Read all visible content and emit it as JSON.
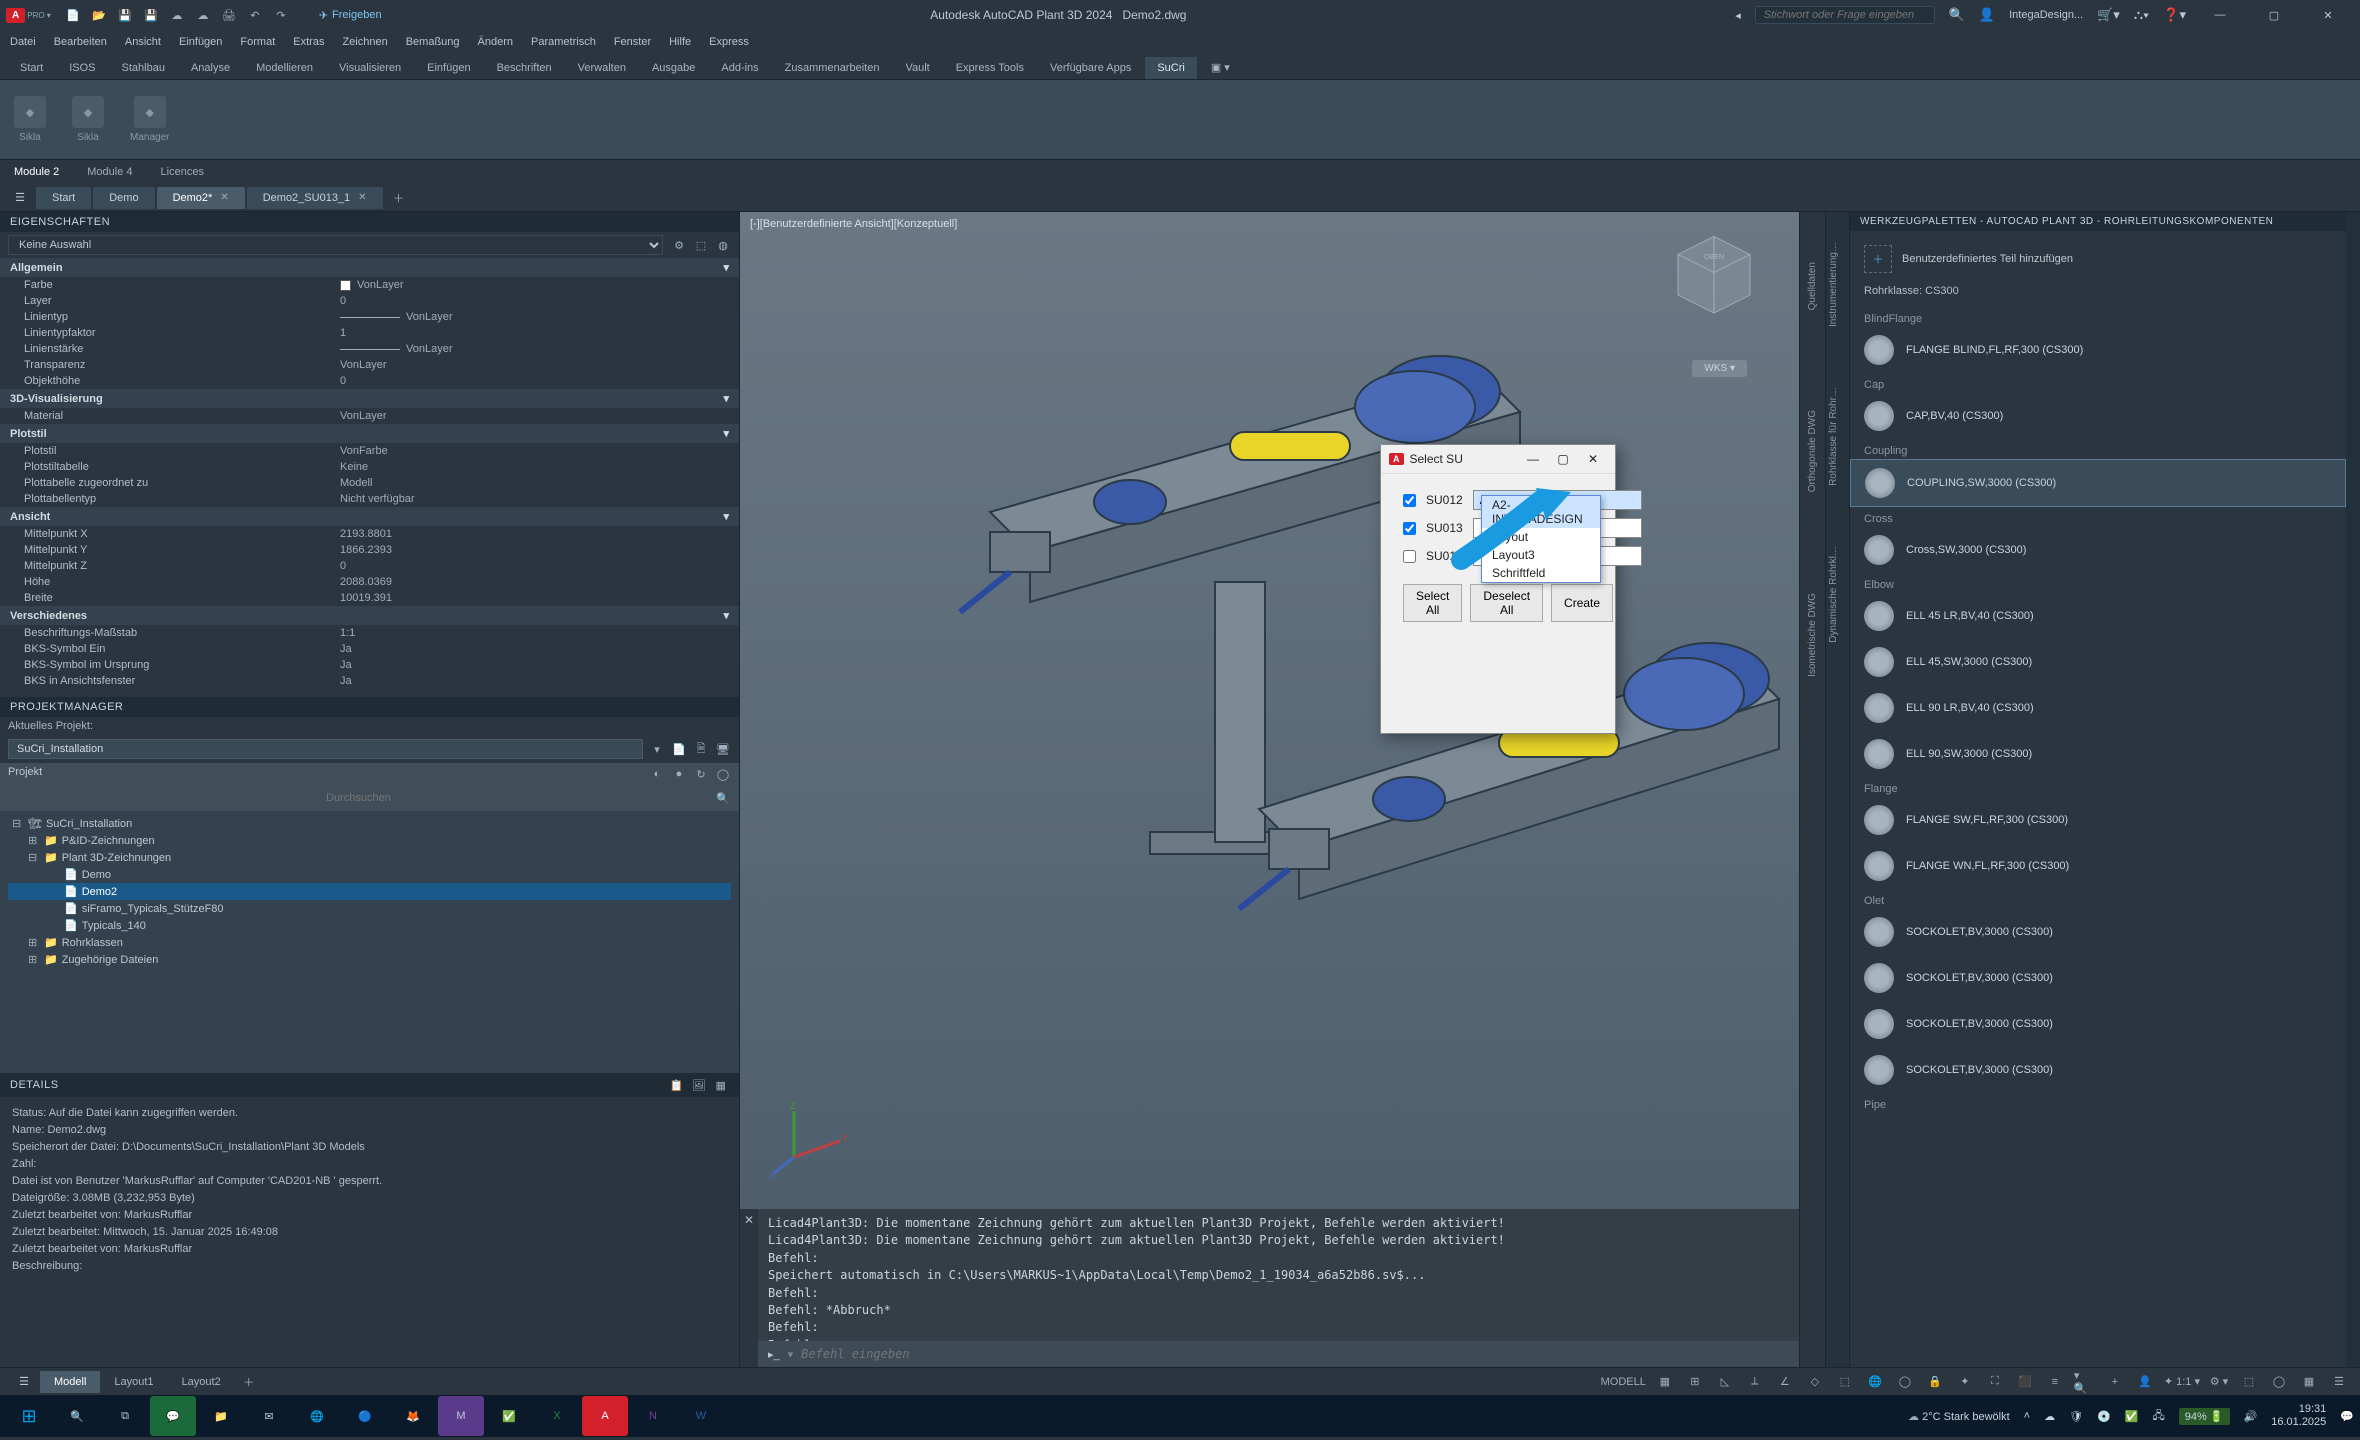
{
  "title_bar": {
    "app_name": "Autodesk AutoCAD Plant 3D 2024",
    "doc_name": "Demo2.dwg",
    "share_label": "Freigeben",
    "search_placeholder": "Stichwort oder Frage eingeben",
    "user_label": "IntegaDesign..."
  },
  "menus": [
    "Datei",
    "Bearbeiten",
    "Ansicht",
    "Einfügen",
    "Format",
    "Extras",
    "Zeichnen",
    "Bemaßung",
    "Ändern",
    "Parametrisch",
    "Fenster",
    "Hilfe",
    "Express"
  ],
  "ribbon_tabs": [
    "Start",
    "ISOS",
    "Stahlbau",
    "Analyse",
    "Modellieren",
    "Visualisieren",
    "Einfügen",
    "Beschriften",
    "Verwalten",
    "Ausgabe",
    "Add-ins",
    "Zusammenarbeiten",
    "Vault",
    "Express Tools",
    "Verfügbare Apps",
    "SuCri"
  ],
  "ribbon_btns": [
    {
      "label": "Sikla"
    },
    {
      "label": "Sikla"
    },
    {
      "label": "Manager"
    }
  ],
  "sub_tabs": [
    "Module 2",
    "Module 4",
    "Licences"
  ],
  "file_tabs": [
    {
      "label": "Start",
      "closable": false
    },
    {
      "label": "Demo",
      "closable": false
    },
    {
      "label": "Demo2*",
      "closable": true,
      "active": true
    },
    {
      "label": "Demo2_SU013_1",
      "closable": true
    }
  ],
  "props_header": "EIGENSCHAFTEN",
  "props_selection": "Keine Auswahl",
  "prop_sections": {
    "allgemein": {
      "title": "Allgemein",
      "rows": [
        {
          "label": "Farbe",
          "value": "VonLayer",
          "swatch": true
        },
        {
          "label": "Layer",
          "value": "0"
        },
        {
          "label": "Linientyp",
          "value": "VonLayer",
          "line": true
        },
        {
          "label": "Linientypfaktor",
          "value": "1"
        },
        {
          "label": "Linienstärke",
          "value": "VonLayer",
          "line": true
        },
        {
          "label": "Transparenz",
          "value": "VonLayer"
        },
        {
          "label": "Objekthöhe",
          "value": "0"
        }
      ]
    },
    "vis3d": {
      "title": "3D-Visualisierung",
      "rows": [
        {
          "label": "Material",
          "value": "VonLayer"
        }
      ]
    },
    "plotstil": {
      "title": "Plotstil",
      "rows": [
        {
          "label": "Plotstil",
          "value": "VonFarbe"
        },
        {
          "label": "Plotstiltabelle",
          "value": "Keine"
        },
        {
          "label": "Plottabelle zugeordnet zu",
          "value": "Modell"
        },
        {
          "label": "Plottabellentyp",
          "value": "Nicht verfügbar"
        }
      ]
    },
    "ansicht": {
      "title": "Ansicht",
      "rows": [
        {
          "label": "Mittelpunkt X",
          "value": "2193.8801"
        },
        {
          "label": "Mittelpunkt Y",
          "value": "1866.2393"
        },
        {
          "label": "Mittelpunkt Z",
          "value": "0"
        },
        {
          "label": "Höhe",
          "value": "2088.0369"
        },
        {
          "label": "Breite",
          "value": "10019.391"
        }
      ]
    },
    "verschiedenes": {
      "title": "Verschiedenes",
      "rows": [
        {
          "label": "Beschriftungs-Maßstab",
          "value": "1:1"
        },
        {
          "label": "BKS-Symbol Ein",
          "value": "Ja"
        },
        {
          "label": "BKS-Symbol im Ursprung",
          "value": "Ja"
        },
        {
          "label": "BKS in Ansichtsfenster",
          "value": "Ja"
        }
      ]
    }
  },
  "projman_header": "PROJEKTMANAGER",
  "projman_current_label": "Aktuelles Projekt:",
  "projman_current_value": "SuCri_Installation",
  "projman_proj_label": "Projekt",
  "projman_search_placeholder": "Durchsuchen",
  "proj_tree": [
    {
      "label": "SuCri_Installation",
      "indent": 0,
      "exp": "-",
      "ico": "proj"
    },
    {
      "label": "P&ID-Zeichnungen",
      "indent": 1,
      "exp": "+",
      "ico": "folder"
    },
    {
      "label": "Plant 3D-Zeichnungen",
      "indent": 1,
      "exp": "-",
      "ico": "folder"
    },
    {
      "label": "Demo",
      "indent": 2,
      "exp": "",
      "ico": "dwg"
    },
    {
      "label": "Demo2",
      "indent": 2,
      "exp": "",
      "ico": "dwg",
      "selected": true
    },
    {
      "label": "siFramo_Typicals_StützeF80",
      "indent": 2,
      "exp": "",
      "ico": "dwg"
    },
    {
      "label": "Typicals_140",
      "indent": 2,
      "exp": "",
      "ico": "dwg"
    },
    {
      "label": "Rohrklassen",
      "indent": 1,
      "exp": "+",
      "ico": "folder"
    },
    {
      "label": "Zugehörige Dateien",
      "indent": 1,
      "exp": "+",
      "ico": "folder"
    }
  ],
  "details_header": "Details",
  "details_lines": [
    "Status: Auf die Datei kann zugegriffen werden.",
    "Name: Demo2.dwg",
    "Speicherort der Datei: D:\\Documents\\SuCri_Installation\\Plant 3D Models",
    "Zahl:",
    "Datei ist von Benutzer 'MarkusRufflar' auf Computer 'CAD201-NB ' gesperrt.",
    "Dateigröße: 3.08MB (3,232,953 Byte)",
    "Zuletzt bearbeitet von: MarkusRufflar",
    "Zuletzt bearbeitet: Mittwoch, 15. Januar 2025 16:49:08",
    "Zuletzt bearbeitet von: MarkusRufflar",
    "Beschreibung:"
  ],
  "viewport_label": "[-][Benutzerdefinierte Ansicht][Konzeptuell]",
  "wks_label": "WKS",
  "dialog": {
    "title": "Select SU",
    "rows": [
      {
        "id": "SU012",
        "value": "A2-INTEGADESIGN",
        "checked": true
      },
      {
        "id": "SU013",
        "value": "",
        "checked": true
      },
      {
        "id": "SU014",
        "value": "",
        "checked": false
      }
    ],
    "dropdown": [
      "A2-INTEGADESIGN",
      "Layout",
      "Layout3",
      "Schriftfeld"
    ],
    "buttons": {
      "select_all": "Select All",
      "deselect_all": "Deselect All",
      "create": "Create"
    }
  },
  "palette_header": "WERKZEUGPALETTEN - AUTOCAD PLANT 3D - ROHRLEITUNGSKOMPONENTEN",
  "palette_custom": "Benutzerdefiniertes Teil hinzufügen",
  "palette_vtabs": [
    "Instrumentierung…",
    "Rohrklasse für Rohr…",
    "Dynamische Rohrkl…"
  ],
  "palette_class": "Rohrklasse: CS300",
  "palette_groups": [
    {
      "title": "BlindFlange",
      "items": [
        "FLANGE BLIND,FL,RF,300 (CS300)"
      ]
    },
    {
      "title": "Cap",
      "items": [
        "CAP,BV,40 (CS300)"
      ]
    },
    {
      "title": "Coupling",
      "items": [
        "COUPLING,SW,3000 (CS300)"
      ],
      "selected": 0
    },
    {
      "title": "Cross",
      "items": [
        "Cross,SW,3000 (CS300)"
      ]
    },
    {
      "title": "Elbow",
      "items": [
        "ELL 45 LR,BV,40 (CS300)",
        "ELL 45,SW,3000 (CS300)",
        "ELL 90 LR,BV,40 (CS300)",
        "ELL 90,SW,3000 (CS300)"
      ]
    },
    {
      "title": "Flange",
      "items": [
        "FLANGE SW,FL,RF,300 (CS300)",
        "FLANGE WN,FL,RF,300 (CS300)"
      ]
    },
    {
      "title": "Olet",
      "items": [
        "SOCKOLET,BV,3000 (CS300)",
        "SOCKOLET,BV,3000 (CS300)",
        "SOCKOLET,BV,3000 (CS300)",
        "SOCKOLET,BV,3000 (CS300)"
      ]
    },
    {
      "title": "Pipe",
      "items": []
    }
  ],
  "cmd_lines": [
    "Licad4Plant3D: Die momentane Zeichnung gehört zum aktuellen Plant3D Projekt, Befehle werden aktiviert!",
    "Licad4Plant3D: Die momentane Zeichnung gehört zum aktuellen Plant3D Projekt, Befehle werden aktiviert!",
    "Befehl:",
    "Speichert automatisch in C:\\Users\\MARKUS~1\\AppData\\Local\\Temp\\Demo2_1_19034_a6a52b86.sv$...",
    "Befehl:",
    "Befehl: *Abbruch*",
    "Befehl:",
    "Befehl:",
    "Befehl:"
  ],
  "cmd_placeholder": "Befehl eingeben",
  "layout_tabs": [
    "Modell",
    "Layout1",
    "Layout2"
  ],
  "status_right": "MODELL",
  "taskbar": {
    "battery": "94%",
    "weather": "2°C Stark bewölkt",
    "time": "19:31",
    "date": "16.01.2025"
  }
}
